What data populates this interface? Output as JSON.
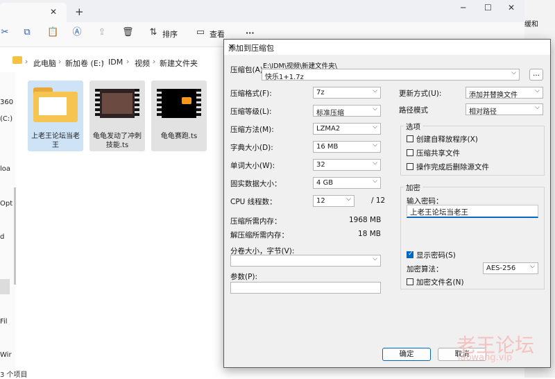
{
  "explorer": {
    "tab_close": "✕",
    "new_tab": "+",
    "window_controls": [
      "─",
      "☐",
      "✕"
    ],
    "toolbar": {
      "sort_label": "排序",
      "view_label": "查看",
      "more_label": "···"
    },
    "breadcrumb": [
      "此电脑",
      "新加卷 (E:)",
      "IDM",
      "视频",
      "新建文件夹"
    ],
    "nav_items": [
      "360",
      "(C:)",
      "loa",
      "Opt",
      "d",
      "Fil",
      "Wir"
    ],
    "files": [
      {
        "name": "上老王论坛当老王",
        "type": "folder"
      },
      {
        "name": "龟龟发动了冲刺技能.ts",
        "type": "video"
      },
      {
        "name": "龟龟赛跑.ts",
        "type": "video"
      }
    ],
    "status": "3 个项目",
    "right_strip_text": "缓和"
  },
  "dialog": {
    "title": "添加到压缩包",
    "archive_label": "压缩包(A)",
    "archive_path": "E:\\IDM\\视频\\新建文件夹\\",
    "archive_name": "快乐1+1.7z",
    "browse_label": "...",
    "format_label": "压缩格式(F):",
    "format_value": "7z",
    "level_label": "压缩等级(L):",
    "level_value": "标准压缩",
    "method_label": "压缩方法(M):",
    "method_value": "LZMA2",
    "dict_label": "字典大小(D):",
    "dict_value": "16 MB",
    "word_label": "单词大小(W):",
    "word_value": "32",
    "solid_label": "固实数据大小：",
    "solid_value": "4 GB",
    "cpu_label": "CPU 线程数：",
    "cpu_value": "12",
    "cpu_total": "/ 12",
    "mem_comp_label": "压缩所需内存：",
    "mem_comp_value": "1968 MB",
    "mem_decomp_label": "解压缩所需内存：",
    "mem_decomp_value": "18 MB",
    "split_label": "分卷大小，字节(V):",
    "split_value": "",
    "params_label": "参数(P):",
    "params_value": "",
    "update_label": "更新方式(U):",
    "update_value": "添加并替换文件",
    "path_label": "路径模式",
    "path_value": "相对路径",
    "options_title": "选项",
    "options": [
      {
        "label": "创建自释放程序(X)",
        "checked": false
      },
      {
        "label": "压缩共享文件",
        "checked": false
      },
      {
        "label": "操作完成后删除源文件",
        "checked": false
      }
    ],
    "encrypt_title": "加密",
    "password_label": "输入密码：",
    "password_value": "上老王论坛当老王",
    "show_password_label": "显示密码(S)",
    "show_password_checked": true,
    "enc_method_label": "加密算法：",
    "enc_method_value": "AES-256",
    "encrypt_names_label": "加密文件名(N)",
    "encrypt_names_checked": false,
    "ok_label": "确定",
    "cancel_label": "取消"
  },
  "watermark": {
    "title": "老王论坛",
    "url": "laowang.vip"
  }
}
